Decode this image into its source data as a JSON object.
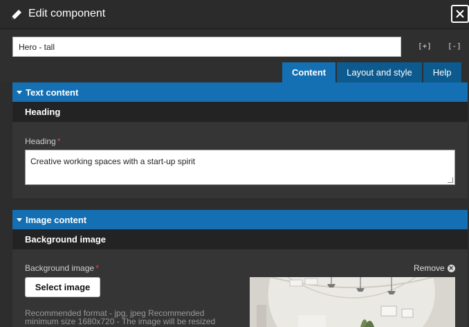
{
  "dialog": {
    "title": "Edit component",
    "icons": {
      "edit": "pencil-icon",
      "close": "close-icon"
    }
  },
  "component_name": {
    "value": "Hero - tall"
  },
  "controls": {
    "expand_all": "[+]",
    "collapse_all": "[-]"
  },
  "tabs": [
    {
      "label": "Content",
      "active": true
    },
    {
      "label": "Layout and style",
      "active": false
    },
    {
      "label": "Help",
      "active": false
    }
  ],
  "sections": {
    "text": {
      "title": "Text content",
      "subheading": "Heading",
      "field_label": "Heading",
      "required_mark": "*",
      "field_value": "Creative working spaces with a start-up spirit"
    },
    "image": {
      "title": "Image content",
      "subheading": "Background image",
      "field_label": "Background image",
      "required_mark": "*",
      "remove_label": "Remove",
      "select_label": "Select image",
      "help_text": "Recommended format - jpg, jpeg Recommended minimum size 1680x720 - The image will be resized"
    }
  },
  "colors": {
    "accent": "#1470b3",
    "tab_inactive": "#0d5a8e",
    "background": "#2d2d2d",
    "required": "#e24a4a"
  }
}
